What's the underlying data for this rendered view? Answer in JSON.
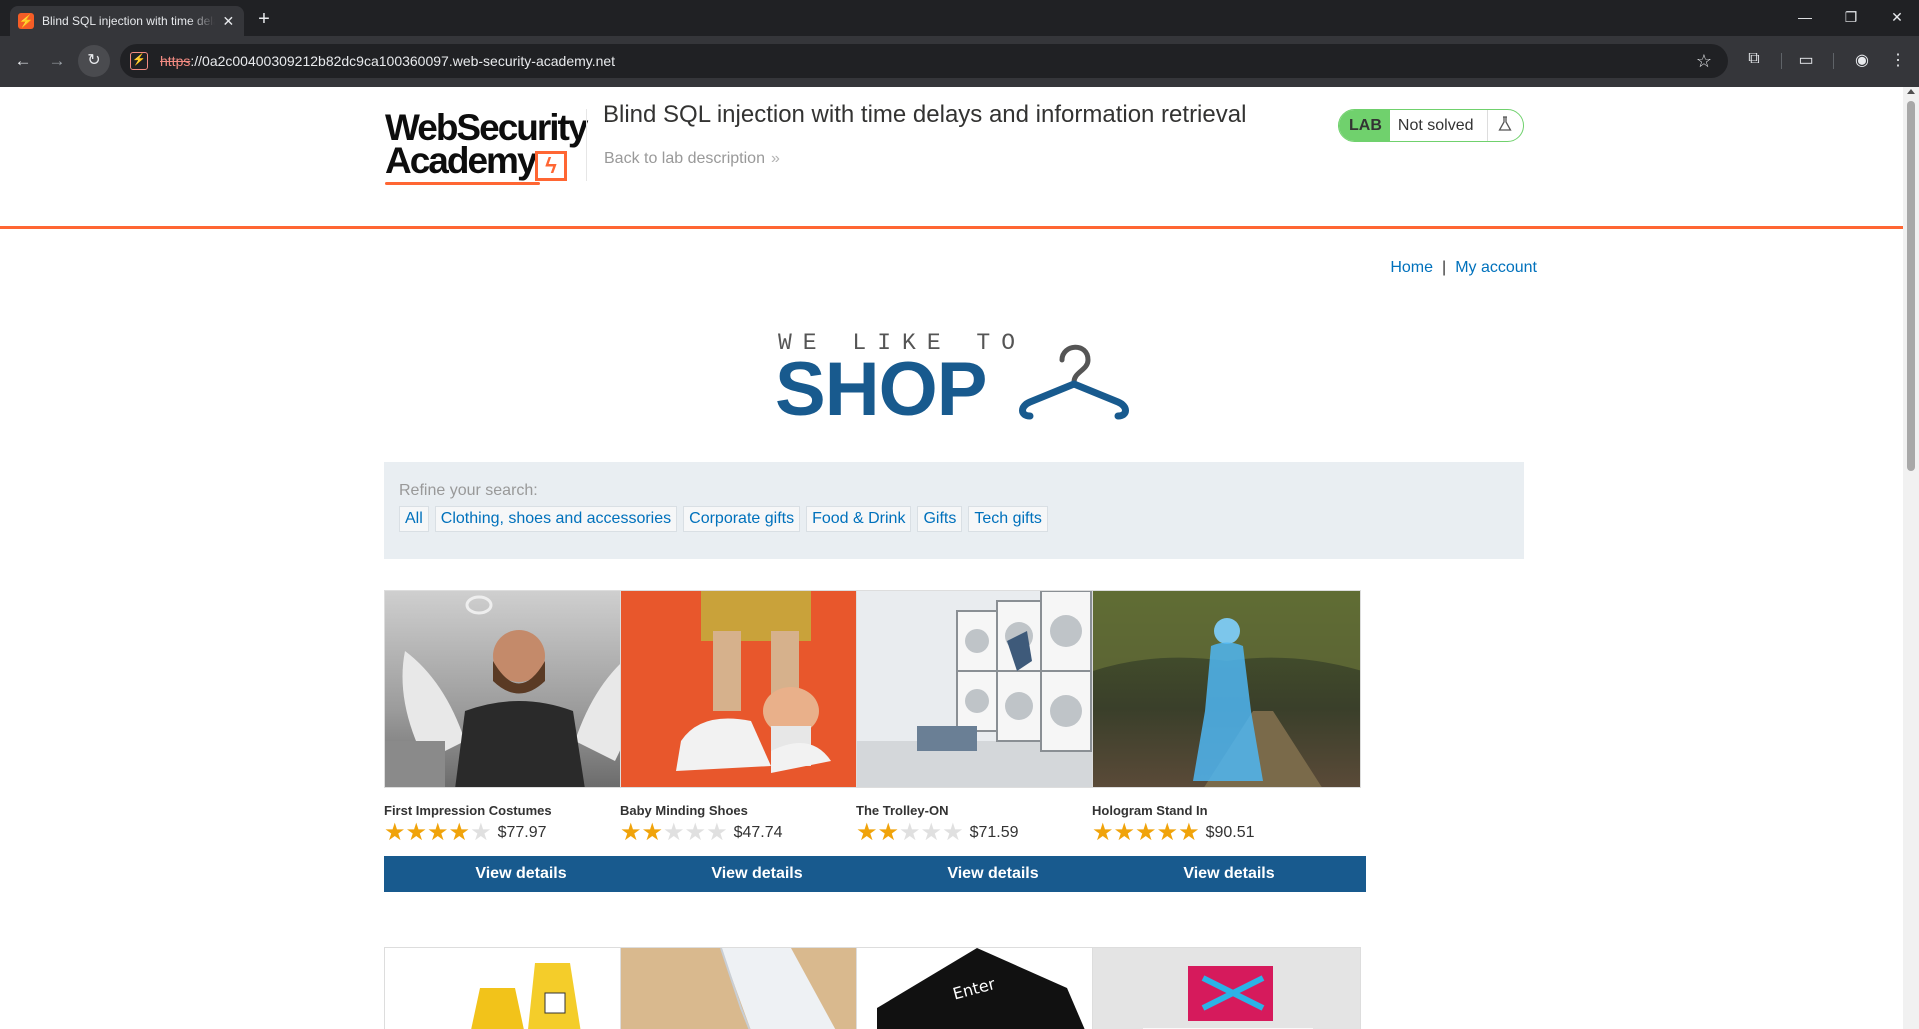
{
  "browser": {
    "tab_title": "Blind SQL injection with time delays",
    "tab_favicon_glyph": "⚡",
    "url_scheme": "https",
    "url_rest": "://0a2c00400309212b82dc9ca100360097.web-security-academy.net"
  },
  "header": {
    "logo_line1": "WebSecurity",
    "logo_line2": "Academy",
    "lab_title": "Blind SQL injection with time delays and information retrieval",
    "back_link": "Back to lab description",
    "lab_badge": "LAB",
    "lab_state": "Not solved"
  },
  "nav": {
    "home": "Home",
    "separator": "|",
    "account": "My account"
  },
  "banner": {
    "small": "WE LIKE TO",
    "big": "SHOP"
  },
  "refine": {
    "label": "Refine your search:",
    "filters": [
      "All",
      "Clothing, shoes and accessories",
      "Corporate gifts",
      "Food & Drink",
      "Gifts",
      "Tech gifts"
    ]
  },
  "products": [
    {
      "name": "First Impression Costumes",
      "rating": 4,
      "price": "$77.97",
      "button": "View details"
    },
    {
      "name": "Baby Minding Shoes",
      "rating": 2,
      "price": "$47.74",
      "button": "View details"
    },
    {
      "name": "The Trolley-ON",
      "rating": 2,
      "price": "$71.59",
      "button": "View details"
    },
    {
      "name": "Hologram Stand In",
      "rating": 5,
      "price": "$90.51",
      "button": "View details"
    }
  ],
  "colors": {
    "accent_orange": "#ff6633",
    "brand_blue": "#185a8e",
    "link_blue": "#0071bc",
    "lab_green": "#70d16d",
    "star_gold": "#f0a30a"
  }
}
